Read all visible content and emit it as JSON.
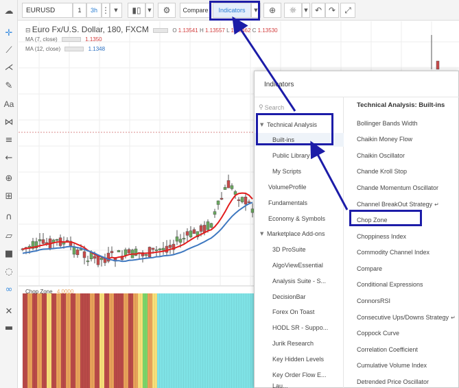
{
  "toolbar": {
    "symbol": "EURUSD",
    "interval_1": "1",
    "interval_3h": "3h",
    "compare_label": "Compare",
    "indicators_label": "Indicators"
  },
  "legend": {
    "title": "Euro Fx/U.S. Dollar, 180, FXCM",
    "o_label": "O",
    "o_value": "1.13541",
    "h_label": "H",
    "h_value": "1.13557",
    "l_label": "L",
    "l_value": "1.13462",
    "c_label": "C",
    "c_value": "1.13530",
    "ma1_label": "MA (7, close)",
    "ma1_value": "1.1350",
    "ma2_label": "MA (12, close)",
    "ma2_value": "1.1348",
    "chop_label": "Chop Zone",
    "chop_value": "4.0000"
  },
  "colors": {
    "accent": "#2a7ed3",
    "annotation": "#1c1ca8",
    "candle_up": "#6aaa5e",
    "candle_down": "#c94a4a",
    "ma_fast": "#e21d1d",
    "ma_slow": "#3e78c0",
    "chop_red": "#b94a48",
    "chop_orange": "#e8a25a",
    "chop_yellow": "#f7e07a",
    "chop_green": "#7cd56a",
    "chop_cyan": "#7fe3e6"
  },
  "panel": {
    "title": "Indicators",
    "search_placeholder": "Search",
    "right_heading": "Technical Analysis: Built-ins",
    "categories": [
      {
        "label": "Technical Analysis"
      },
      {
        "label": "Built-ins"
      },
      {
        "label": "Public Library"
      },
      {
        "label": "My Scripts"
      },
      {
        "label": "VolumeProfile"
      },
      {
        "label": "Fundamentals"
      },
      {
        "label": "Economy & Symbols"
      },
      {
        "label": "Marketplace Add-ons"
      },
      {
        "label": "3D ProSuite"
      },
      {
        "label": "AlgoViewEssential"
      },
      {
        "label": "Analysis Suite - S..."
      },
      {
        "label": "DecisionBar"
      },
      {
        "label": "Forex On Toast"
      },
      {
        "label": "HODL SR - Suppo..."
      },
      {
        "label": "Jurik Research"
      },
      {
        "label": "Key Hidden Levels"
      },
      {
        "label": "Key Order Flow E..."
      },
      {
        "label": "Lau..."
      }
    ],
    "indicators": [
      {
        "label": "Bollinger Bands Width"
      },
      {
        "label": "Chaikin Money Flow"
      },
      {
        "label": "Chaikin Oscillator"
      },
      {
        "label": "Chande Kroll Stop"
      },
      {
        "label": "Chande Momentum Oscillator"
      },
      {
        "label": "Channel BreakOut Strategy",
        "tag": "↵"
      },
      {
        "label": "Chop Zone"
      },
      {
        "label": "Choppiness Index"
      },
      {
        "label": "Commodity Channel Index"
      },
      {
        "label": "Compare"
      },
      {
        "label": "Conditional Expressions"
      },
      {
        "label": "ConnorsRSI"
      },
      {
        "label": "Consecutive Ups/Downs Strategy",
        "tag": "↵"
      },
      {
        "label": "Coppock Curve"
      },
      {
        "label": "Correlation Coefficient"
      },
      {
        "label": "Cumulative Volume Index"
      },
      {
        "label": "Detrended Price Oscillator"
      }
    ]
  }
}
